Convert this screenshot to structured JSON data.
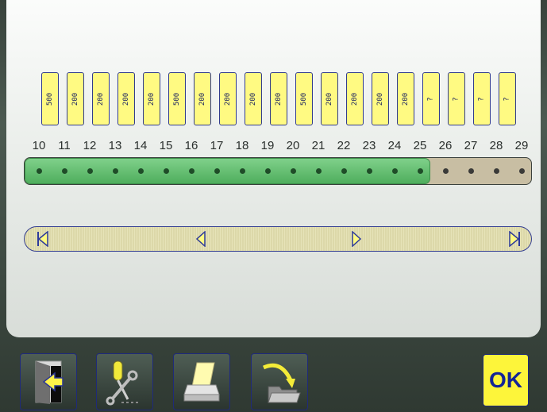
{
  "timeline": {
    "tags": [
      "500",
      "200",
      "200",
      "200",
      "200",
      "500",
      "200",
      "200",
      "200",
      "200",
      "500",
      "200",
      "200",
      "200",
      "200",
      "?",
      "?",
      "?",
      "?"
    ],
    "numbers": [
      "10",
      "11",
      "12",
      "13",
      "14",
      "15",
      "16",
      "17",
      "18",
      "19",
      "20",
      "21",
      "22",
      "23",
      "24",
      "25",
      "26",
      "27",
      "28",
      "29"
    ],
    "completed_count": 16
  },
  "toolbar": {
    "ok_label": "OK",
    "buttons": [
      "exit-door-icon",
      "tools-icon",
      "printer-icon",
      "folder-import-icon"
    ]
  },
  "colors": {
    "tag_fill": "#fffa82",
    "progress_green": "#4fae5d",
    "track_tan": "#c8bea3",
    "ok_yellow": "#fdf53a",
    "ok_text": "#142596"
  }
}
